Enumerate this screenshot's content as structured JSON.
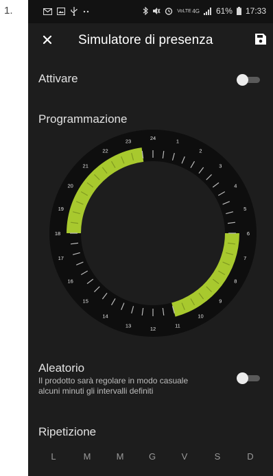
{
  "list_marker": "1.",
  "status_bar": {
    "notification_icons": [
      "mail-icon",
      "image-icon",
      "usb-icon",
      "more-dots-icon"
    ],
    "system_icons": [
      "bluetooth-icon",
      "mute-icon",
      "alarm-icon",
      "volte-icon",
      "4g-icon",
      "signal-icon",
      "battery-icon"
    ],
    "volte_text": "VoLTE",
    "network_text": "4G",
    "battery": "61%",
    "time": "17:33"
  },
  "app_bar": {
    "title": "Simulatore di presenza",
    "close_icon": "close-icon",
    "save_icon": "save-icon"
  },
  "activate": {
    "label": "Attivare",
    "enabled": false
  },
  "schedule": {
    "label": "Programmazione",
    "hours": [
      "24",
      "1",
      "2",
      "3",
      "4",
      "5",
      "6",
      "7",
      "8",
      "9",
      "10",
      "11",
      "12",
      "13",
      "14",
      "15",
      "16",
      "17",
      "18",
      "19",
      "20",
      "21",
      "22",
      "23"
    ],
    "active_ranges": [
      {
        "from": 18,
        "to": 23.5
      },
      {
        "from": 6,
        "to": 11
      }
    ],
    "active_color": "#a8c92e"
  },
  "random": {
    "label": "Aleatorio",
    "description_line1": "Il prodotto sarà regolare in modo casuale",
    "description_line2": "alcuni minuti gli intervalli definiti",
    "enabled": false
  },
  "repeat": {
    "label": "Ripetizione",
    "days": [
      "L",
      "M",
      "M",
      "G",
      "V",
      "S",
      "D"
    ]
  }
}
